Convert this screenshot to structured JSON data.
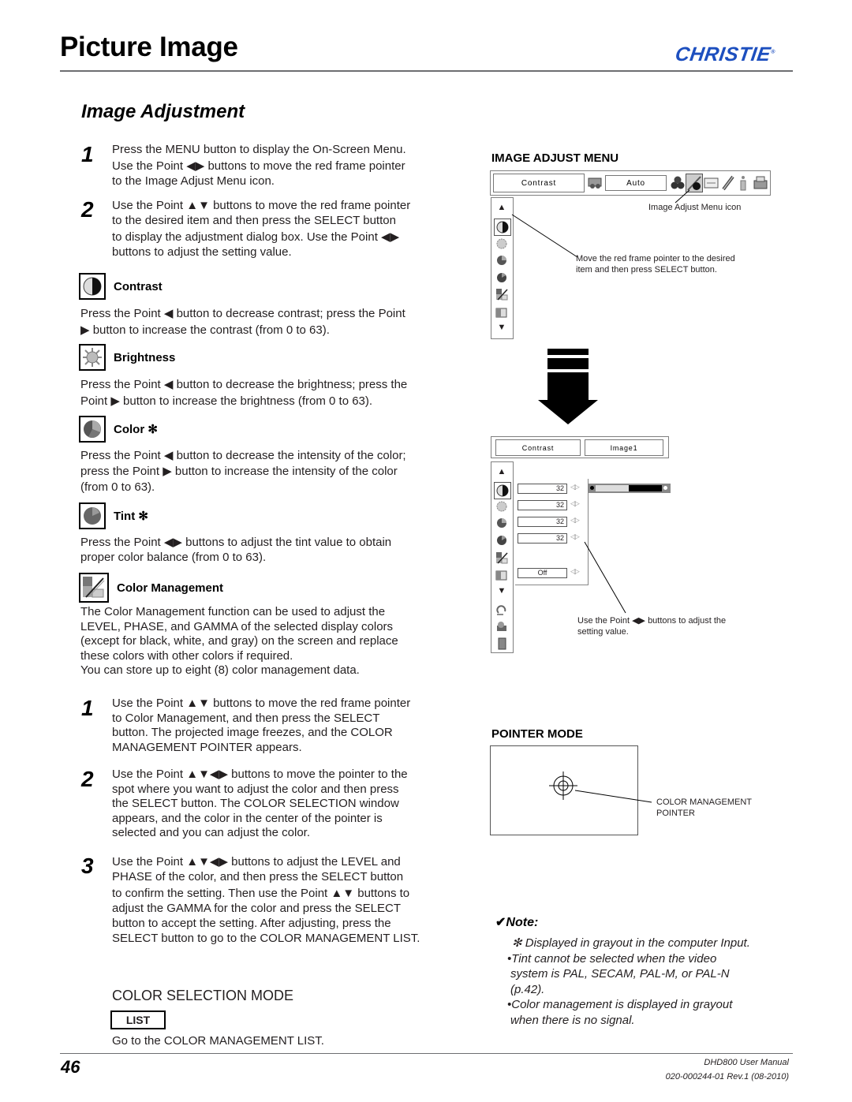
{
  "header": {
    "title": "Picture Image",
    "logo_text": "CHRISTIE",
    "logo_mark": "®",
    "brand_color": "#1d4fbf"
  },
  "section_title": "Image Adjustment",
  "intro_steps": [
    {
      "num": "1",
      "lines": [
        "Press the MENU button to display the On-Screen Menu.",
        "Use the Point ◀▶ buttons to move the red frame pointer",
        "to the Image Adjust Menu icon."
      ]
    },
    {
      "num": "2",
      "lines": [
        "Use the Point ▲▼ buttons to move the red frame pointer",
        "to the desired item and then press the SELECT button",
        "to display the adjustment dialog box. Use the Point ◀▶",
        "buttons to adjust the setting value."
      ]
    }
  ],
  "items": [
    {
      "icon": "contrast-icon",
      "label": "Contrast",
      "lines": [
        "Press the Point ◀ button to decrease contrast; press the Point",
        "▶ button to increase the contrast (from 0 to 63)."
      ]
    },
    {
      "icon": "brightness-icon",
      "label": "Brightness",
      "lines": [
        "Press the Point ◀ button to decrease the brightness; press the",
        "Point ▶ button to increase the brightness (from 0 to 63)."
      ]
    },
    {
      "icon": "color-icon",
      "label": "Color ✻",
      "lines": [
        "Press the Point ◀ button to decrease the intensity of the color;",
        "press the Point ▶ button to increase the intensity of the color",
        "(from 0 to 63)."
      ]
    },
    {
      "icon": "tint-icon",
      "label": "Tint ✻",
      "lines": [
        "Press the Point ◀▶ buttons to adjust the tint value to obtain",
        "proper color balance (from 0 to 63)."
      ]
    },
    {
      "icon": "color-management-icon",
      "label": "Color Management",
      "lines": [
        "The Color Management function can be used to adjust the",
        "LEVEL, PHASE, and GAMMA of the selected display colors",
        "(except for black, white, and gray) on the screen and replace",
        "these colors with other colors if required.",
        "You can store up to eight (8) color management data."
      ]
    }
  ],
  "cm_steps": [
    {
      "num": "1",
      "lines": [
        "Use the Point ▲▼ buttons to move the red frame pointer",
        "to Color Management, and then press the SELECT",
        "button. The projected image freezes, and the COLOR",
        "MANAGEMENT POINTER appears."
      ]
    },
    {
      "num": "2",
      "lines": [
        "Use the Point ▲▼◀▶ buttons to move the pointer to the",
        "spot where you want to adjust the color and then press",
        "the SELECT button. The COLOR SELECTION window",
        "appears, and the color in the center of the pointer is",
        "selected and you can adjust the color."
      ]
    },
    {
      "num": "3",
      "lines": [
        "Use the Point ▲▼◀▶ buttons to adjust the LEVEL and",
        "PHASE of the color, and then press the SELECT button",
        "to confirm the setting. Then use the Point ▲▼ buttons to",
        "adjust the GAMMA for the color and press the SELECT",
        "button to accept the setting. After adjusting, press the",
        "SELECT button to go to the COLOR MANAGEMENT LIST."
      ]
    }
  ],
  "color_selection": {
    "heading": "COLOR SELECTION MODE",
    "button": "LIST",
    "desc": "Go to the COLOR MANAGEMENT LIST."
  },
  "image_adjust_menu": {
    "heading": "IMAGE ADJUST MENU",
    "menubar": {
      "item": "Contrast",
      "mode": "Auto"
    },
    "icon_caption": "Image Adjust Menu icon",
    "pointer_caption": [
      "Move the red frame pointer to the desired",
      "item and then press SELECT button."
    ]
  },
  "dialog_menu": {
    "menubar": {
      "item": "Contrast",
      "mode": "Image1"
    },
    "values": [
      "32",
      "32",
      "32",
      "32",
      "Off"
    ],
    "slider_fraction": 0.5,
    "caption": [
      "Use the Point ◀▶ buttons to adjust the",
      "setting value."
    ]
  },
  "pointer_mode": {
    "heading": "POINTER MODE",
    "caption": [
      "COLOR MANAGEMENT",
      "POINTER"
    ]
  },
  "note": {
    "heading": "Note:",
    "lines": [
      "✻ Displayed in grayout in the computer Input.",
      "•Tint cannot be selected when the video",
      "system is PAL, SECAM, PAL-M, or PAL-N",
      "(p.42).",
      "•Color management is displayed in grayout",
      "when there is no signal."
    ]
  },
  "footer": {
    "page_number": "46",
    "manual": "DHD800 User Manual",
    "doc_id": "020-000244-01 Rev.1 (08-2010)"
  }
}
